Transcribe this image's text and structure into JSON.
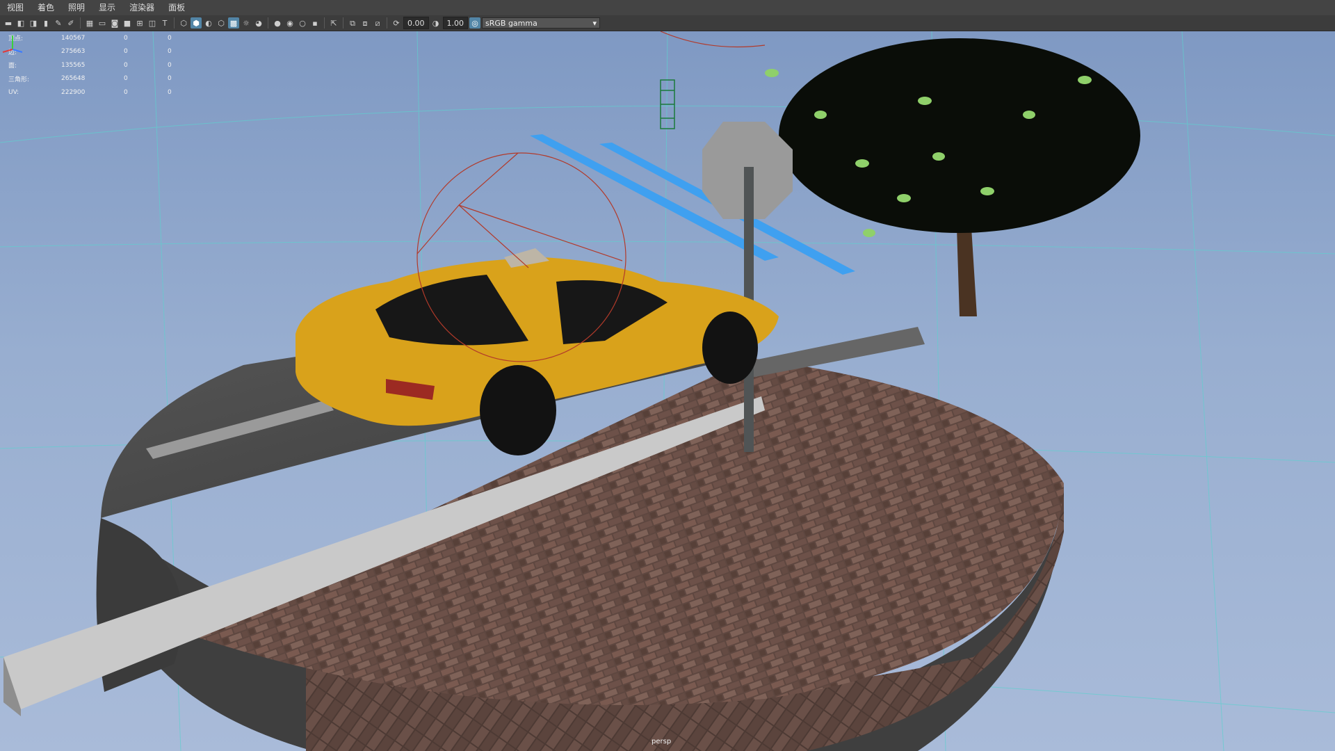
{
  "menubar": {
    "items": [
      "视图",
      "着色",
      "照明",
      "显示",
      "渲染器",
      "面板"
    ]
  },
  "toolbar": {
    "exposure": "0.00",
    "gamma": "1.00",
    "color_space": "sRGB gamma",
    "icons": [
      "camera-icon",
      "camera-attributes-icon",
      "bookmark-icon",
      "image-plane-icon",
      "grid-icon",
      "film-gate-icon",
      "resolution-gate-icon",
      "gate-mask-icon",
      "field-chart-icon",
      "safe-action-icon",
      "safe-title-icon",
      "wireframe-icon",
      "smooth-shade-icon",
      "default-material-icon",
      "textured-icon",
      "use-lights-icon",
      "shadows-icon",
      "screen-space-ao-icon",
      "motion-blur-icon",
      "anti-aliasing-icon",
      "depth-of-field-icon",
      "isolate-select-icon",
      "xray-icon",
      "xray-joints-icon",
      "xray-active-icon",
      "exposure-icon",
      "gamma-icon",
      "color-management-icon"
    ]
  },
  "hud": {
    "rows": [
      {
        "label": "顶点:",
        "v1": "140567",
        "v2": "0",
        "v3": "0"
      },
      {
        "label": "边:",
        "v1": "275663",
        "v2": "0",
        "v3": "0"
      },
      {
        "label": "面:",
        "v1": "135565",
        "v2": "0",
        "v3": "0"
      },
      {
        "label": "三角形:",
        "v1": "265648",
        "v2": "0",
        "v3": "0"
      },
      {
        "label": "UV:",
        "v1": "222900",
        "v2": "0",
        "v3": "0"
      }
    ]
  },
  "viewport": {
    "camera": "persp"
  },
  "colors": {
    "menubar_bg": "#444444",
    "toolbar_bg": "#3c3c3c",
    "viewport_top": "#7f99c3",
    "viewport_bottom": "#a9bbd9",
    "grid_line": "#5fd0cf",
    "taxi_yellow": "#d9a21b",
    "light_blue": "#3fa0f0",
    "brick": "#6b4e44",
    "asphalt": "#4a4a4a"
  }
}
